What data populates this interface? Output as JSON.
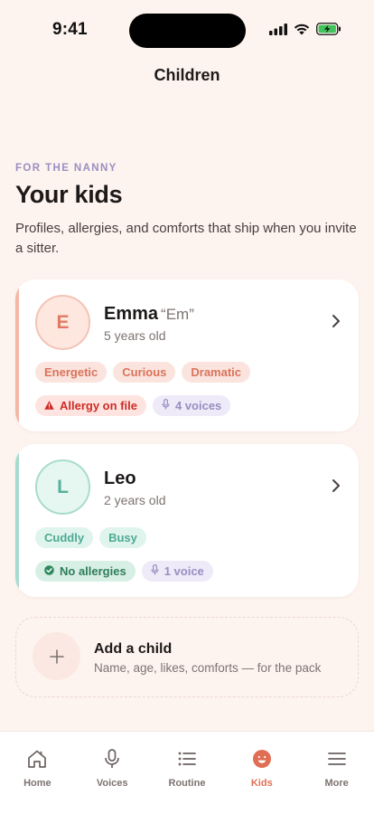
{
  "status_bar": {
    "time": "9:41"
  },
  "header": {
    "title": "Children"
  },
  "intro": {
    "eyebrow": "FOR THE NANNY",
    "title": "Your kids",
    "subtitle": "Profiles, allergies, and comforts that ship when you invite a sitter."
  },
  "children": [
    {
      "initial": "E",
      "name": "Emma",
      "nickname": "“Em”",
      "age": "5 years old",
      "accent": "#f4b8a7",
      "traits": [
        "Energetic",
        "Curious",
        "Dramatic"
      ],
      "allergy": "Allergy on file",
      "voices": "4 voices"
    },
    {
      "initial": "L",
      "name": "Leo",
      "nickname": "",
      "age": "2 years old",
      "accent": "#a6dccf",
      "traits": [
        "Cuddly",
        "Busy"
      ],
      "allergy": "No allergies",
      "voices": "1 voice"
    }
  ],
  "add_child": {
    "title": "Add a child",
    "subtitle": "Name, age, likes, comforts — for the pack"
  },
  "tabs": [
    {
      "label": "Home",
      "icon": "home-icon"
    },
    {
      "label": "Voices",
      "icon": "microphone-icon"
    },
    {
      "label": "Routine",
      "icon": "list-icon"
    },
    {
      "label": "Kids",
      "icon": "smiley-face-icon"
    },
    {
      "label": "More",
      "icon": "menu-icon"
    }
  ],
  "active_tab": "Kids",
  "colors": {
    "background": "#fdf3ef",
    "accent": "#e06e55",
    "warm_chip_bg": "#fbe4dd",
    "warm_chip_text": "#d9735c",
    "mint_chip_bg": "#e0f4ee",
    "mint_chip_text": "#4daa92",
    "voice_chip_bg": "#eeeaf8",
    "voice_chip_text": "#9a8ec2",
    "allergy_red": "#cf2a25"
  }
}
